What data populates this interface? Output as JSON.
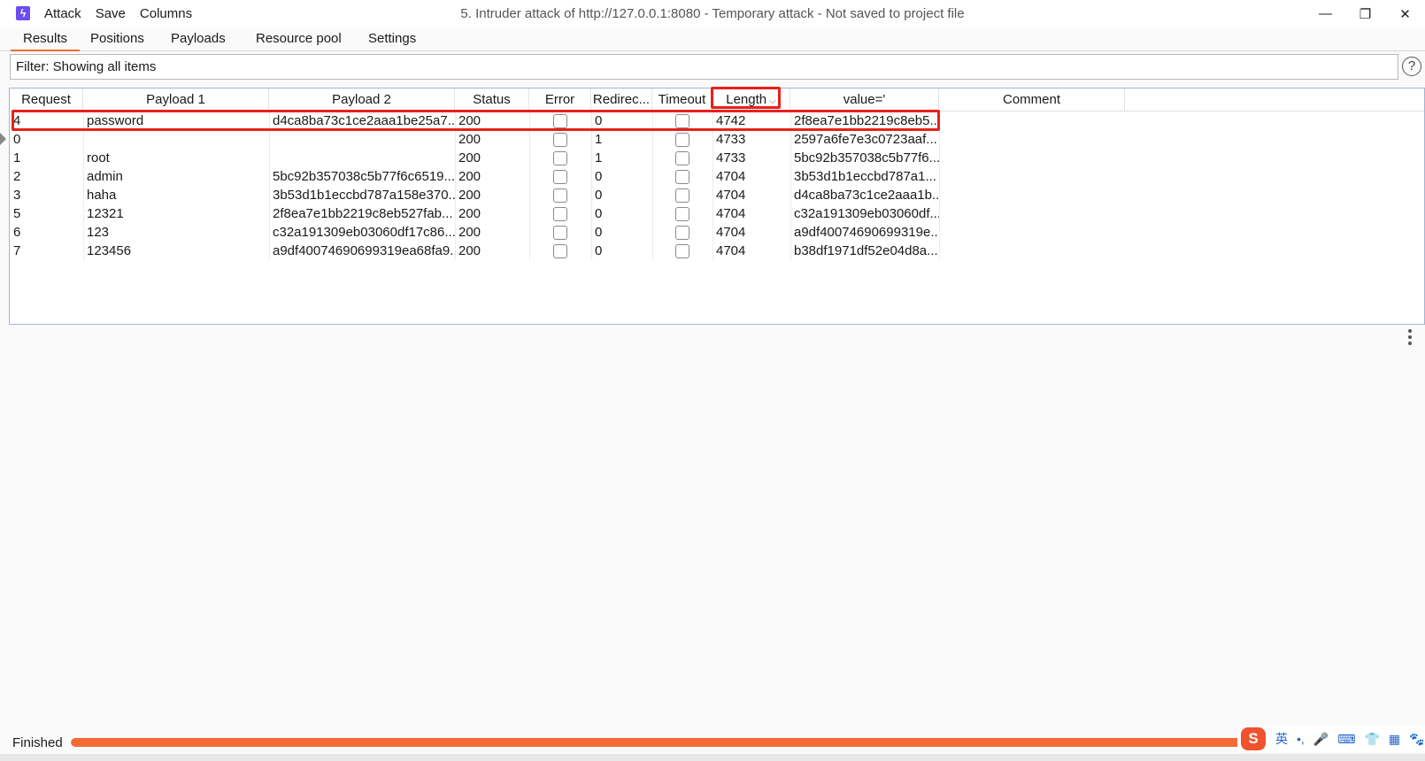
{
  "app": {
    "icon": "burp-lightning-icon",
    "menu": [
      "Attack",
      "Save",
      "Columns"
    ],
    "window_title": "5. Intruder attack of http://127.0.0.1:8080 - Temporary attack - Not saved to project file",
    "controls": {
      "minimize": "—",
      "restore": "❐",
      "close": "✕"
    }
  },
  "tabs": [
    {
      "label": "Results",
      "active": true
    },
    {
      "label": "Positions",
      "active": false
    },
    {
      "label": "Payloads",
      "active": false
    },
    {
      "label": "Resource pool",
      "active": false
    },
    {
      "label": "Settings",
      "active": false
    }
  ],
  "filter": {
    "text": "Filter: Showing all items",
    "help": "?"
  },
  "table": {
    "columns": [
      "Request",
      "Payload 1",
      "Payload 2",
      "Status",
      "Error",
      "Redirec...",
      "Timeout",
      "Length",
      "value='",
      "Comment"
    ],
    "sort_indicator": "⌵",
    "rows": [
      {
        "request": "4",
        "payload1": "password",
        "payload2": "d4ca8ba73c1ce2aaa1be25a7...",
        "status": "200",
        "error": false,
        "redirects": "0",
        "timeout": false,
        "length": "4742",
        "value": "2f8ea7e1bb2219c8eb5...",
        "comment": ""
      },
      {
        "request": "0",
        "payload1": "",
        "payload2": "",
        "status": "200",
        "error": false,
        "redirects": "1",
        "timeout": false,
        "length": "4733",
        "value": "2597a6fe7e3c0723aaf...",
        "comment": ""
      },
      {
        "request": "1",
        "payload1": "root",
        "payload2": "",
        "status": "200",
        "error": false,
        "redirects": "1",
        "timeout": false,
        "length": "4733",
        "value": "5bc92b357038c5b77f6...",
        "comment": ""
      },
      {
        "request": "2",
        "payload1": "admin",
        "payload2": "5bc92b357038c5b77f6c6519...",
        "status": "200",
        "error": false,
        "redirects": "0",
        "timeout": false,
        "length": "4704",
        "value": "3b53d1b1eccbd787a1...",
        "comment": ""
      },
      {
        "request": "3",
        "payload1": "haha",
        "payload2": "3b53d1b1eccbd787a158e370...",
        "status": "200",
        "error": false,
        "redirects": "0",
        "timeout": false,
        "length": "4704",
        "value": "d4ca8ba73c1ce2aaa1b...",
        "comment": ""
      },
      {
        "request": "5",
        "payload1": "12321",
        "payload2": "2f8ea7e1bb2219c8eb527fab...",
        "status": "200",
        "error": false,
        "redirects": "0",
        "timeout": false,
        "length": "4704",
        "value": "c32a191309eb03060df...",
        "comment": ""
      },
      {
        "request": "6",
        "payload1": "123",
        "payload2": "c32a191309eb03060df17c86...",
        "status": "200",
        "error": false,
        "redirects": "0",
        "timeout": false,
        "length": "4704",
        "value": "a9df40074690699319e...",
        "comment": ""
      },
      {
        "request": "7",
        "payload1": "123456",
        "payload2": "a9df40074690699319ea68fa9...",
        "status": "200",
        "error": false,
        "redirects": "0",
        "timeout": false,
        "length": "4704",
        "value": "b38df1971df52e04d8a...",
        "comment": ""
      }
    ]
  },
  "status_bar": {
    "label": "Finished",
    "progress": 1.0
  },
  "ime": {
    "logo": "S",
    "items": [
      "英",
      "•,",
      "🎤",
      "⌨",
      "👕",
      "▦",
      "🐾"
    ]
  },
  "colors": {
    "accent": "#f06a37",
    "highlight": "#e8201a",
    "progress": "#f46a35"
  }
}
